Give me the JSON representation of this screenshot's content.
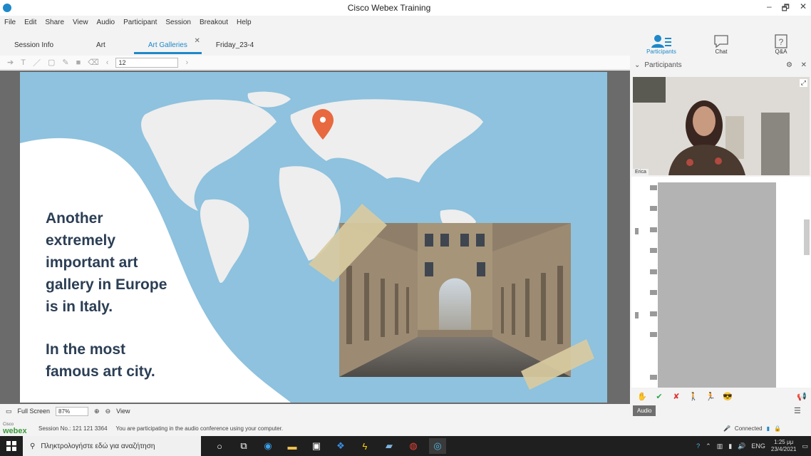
{
  "window": {
    "title": "Cisco Webex Training",
    "controls": [
      "–",
      "🗗",
      "✕"
    ]
  },
  "menu": [
    "File",
    "Edit",
    "Share",
    "View",
    "Audio",
    "Participant",
    "Session",
    "Breakout",
    "Help"
  ],
  "tabs": [
    {
      "label": "Session Info",
      "active": false
    },
    {
      "label": "Art",
      "active": false
    },
    {
      "label": "Art Galleries",
      "active": true
    },
    {
      "label": "Friday_23-4",
      "active": false
    }
  ],
  "toolbar": {
    "font_size": "12"
  },
  "slide": {
    "lines1": "Another\nextremely\nimportant art\ngallery in Europe\nis in Italy.",
    "lines2": "In the most\nfamous art city."
  },
  "right_panel": {
    "buttons": [
      {
        "label": "Participants",
        "icon": "participants-icon"
      },
      {
        "label": "Chat",
        "icon": "chat-icon"
      },
      {
        "label": "Q&A",
        "icon": "qa-icon"
      }
    ],
    "header": "Participants",
    "video_name": "Erica"
  },
  "audio_tip": "Audio",
  "status": {
    "full_screen": "Full Screen",
    "zoom": "87%",
    "view": "View"
  },
  "session": {
    "logo_top": "Cisco",
    "logo": "webex",
    "number": "Session No.: 121 121 3364",
    "message": "You are participating in the audio conference using your computer.",
    "connected": "Connected"
  },
  "taskbar": {
    "search_placeholder": "Πληκτρολογήστε εδώ για αναζήτηση",
    "language": "ENG",
    "time": "1:25 μμ",
    "date": "23/4/2021"
  },
  "colors": {
    "accent": "#1e88c9",
    "slide_bg": "#8ec2de",
    "slide_text": "#2b3e55",
    "pin": "#e8693f"
  }
}
